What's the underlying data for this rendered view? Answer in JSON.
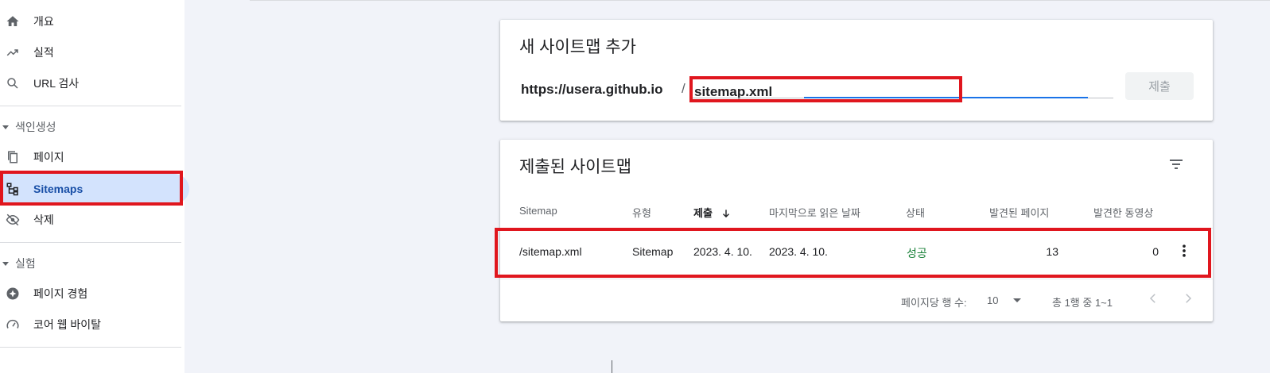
{
  "sidebar": {
    "items": [
      {
        "label": "개요"
      },
      {
        "label": "실적"
      },
      {
        "label": "URL 검사"
      },
      {
        "label": "페이지"
      },
      {
        "label": "Sitemaps"
      },
      {
        "label": "삭제"
      },
      {
        "label": "페이지 경험"
      },
      {
        "label": "코어 웹 바이탈"
      }
    ],
    "sections": [
      {
        "label": "색인생성"
      },
      {
        "label": "실험"
      }
    ]
  },
  "add_sitemap": {
    "title": "새 사이트맵 추가",
    "prefix": "https://usera.github.io",
    "separator": "/",
    "input_value": "sitemap.xml",
    "submit_label": "제출"
  },
  "submitted": {
    "title": "제출된 사이트맵",
    "columns": {
      "sitemap": "Sitemap",
      "type": "유형",
      "submitted": "제출",
      "last_read": "마지막으로 읽은 날짜",
      "status": "상태",
      "pages": "발견된 페이지",
      "videos": "발견한 동영상"
    },
    "rows": [
      {
        "sitemap": "/sitemap.xml",
        "type": "Sitemap",
        "submitted": "2023. 4. 10.",
        "last_read": "2023. 4. 10.",
        "status": "성공",
        "pages": "13",
        "videos": "0"
      }
    ],
    "pagination": {
      "rows_per_page_label": "페이지당 행 수:",
      "rows_per_page": "10",
      "range": "총 1행 중 1~1"
    }
  },
  "colors": {
    "accent": "#1a73e8",
    "success": "#188038",
    "highlight": "#e0161e"
  }
}
